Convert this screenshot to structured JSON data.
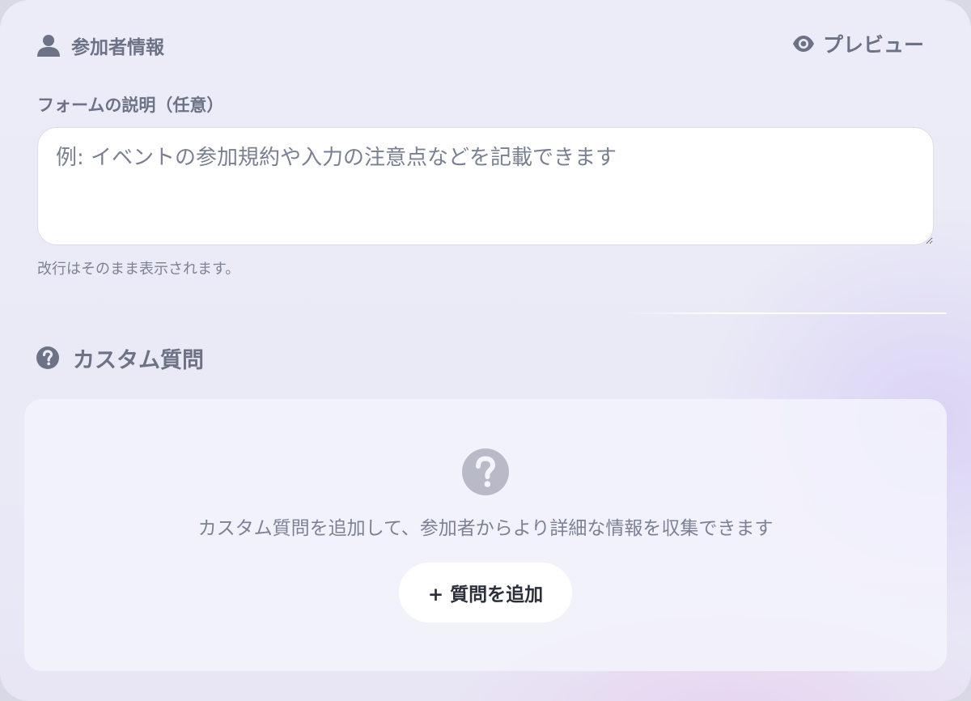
{
  "participant_section": {
    "title": "参加者情報",
    "icon": "user-icon"
  },
  "preview": {
    "label": "プレビュー",
    "icon": "eye-icon"
  },
  "form_description": {
    "label": "フォームの説明（任意）",
    "placeholder": "例: イベントの参加規約や入力の注意点などを記載できます",
    "value": "",
    "helper": "改行はそのまま表示されます。"
  },
  "custom_questions": {
    "title": "カスタム質問",
    "icon": "question-circle-icon",
    "empty_icon": "question-circle-icon",
    "empty_message": "カスタム質問を追加して、参加者からより詳細な情報を収集できます",
    "add_button_label": "+ 質問を追加"
  },
  "colors": {
    "text_muted": "#6d7286",
    "panel_bg": "#f4f4fc",
    "button_bg": "#ffffff",
    "empty_icon": "#b9bac8"
  }
}
